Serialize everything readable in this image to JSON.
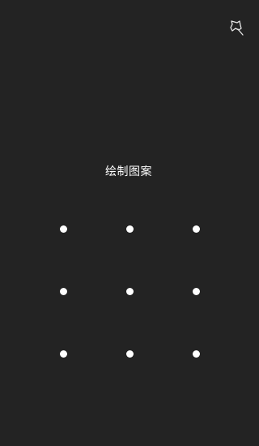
{
  "screen": {
    "background_color": "#232323",
    "corner_icon": "pin-icon",
    "title": "绘制图案"
  },
  "pattern": {
    "dot_color": "#ffffff",
    "rows": 3,
    "cols": 3,
    "dots": [
      1,
      2,
      3,
      4,
      5,
      6,
      7,
      8,
      9
    ]
  }
}
